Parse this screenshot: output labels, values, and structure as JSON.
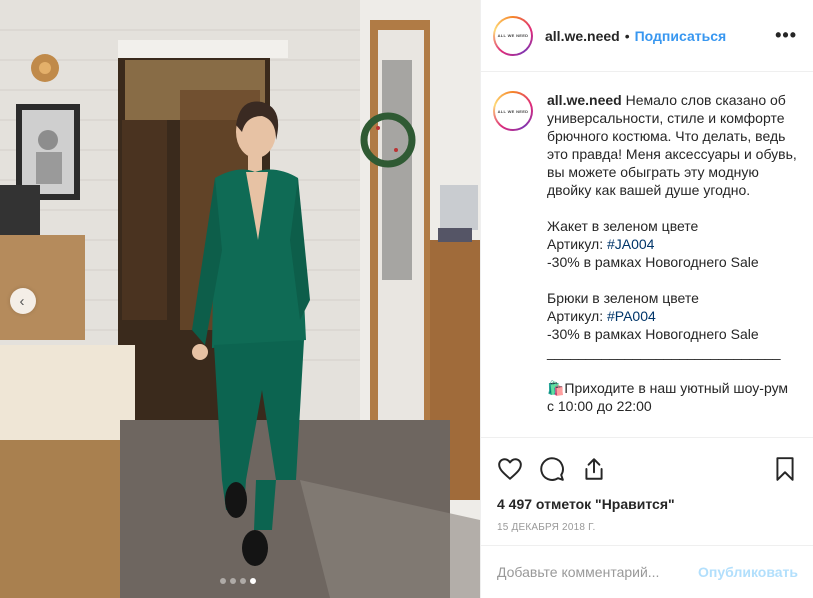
{
  "post": {
    "username": "all.we.need",
    "avatar_text": "ALL WE NEED",
    "separator": "•",
    "follow_label": "Подписаться",
    "more_label": "•••"
  },
  "caption": {
    "username": "all.we.need",
    "intro": " Немало слов сказано об универсальности, стиле и комфорте брючного костюма. Что делать, ведь это правда! Меня аксессуары и обувь, вы можете обыграть эту модную двойку как вашей душе угодно.",
    "item1_title": "Жакет в зеленом цвете",
    "item1_article_label": "Артикул: ",
    "item1_tag": "#JA004",
    "item1_sale": "-30% в рамках Новогоднего Sale",
    "item2_title": "Брюки в зеленом цвете",
    "item2_article_label": "Артикул: ",
    "item2_tag": "#PA004",
    "item2_sale": "-30% в рамках Новогоднего Sale",
    "divider": "______________________________",
    "showroom": "🛍️Приходите в наш уютный шоу-рум с 10:00 до 22:00"
  },
  "stats": {
    "likes": "4 497 отметок \"Нравится\"",
    "date": "15 декабря 2018 г."
  },
  "comment": {
    "placeholder": "Добавьте комментарий...",
    "publish_label": "Опубликовать"
  },
  "carousel": {
    "prev_glyph": "‹",
    "count": 4,
    "active_index": 3
  },
  "colors": {
    "accent": "#3897f0",
    "hashtag": "#003569",
    "suit": "#0f6b55",
    "publish_disabled": "#b2dffc"
  },
  "icons": [
    "heart-icon",
    "comment-icon",
    "share-icon",
    "bookmark-icon",
    "chevron-left-icon",
    "more-icon"
  ]
}
